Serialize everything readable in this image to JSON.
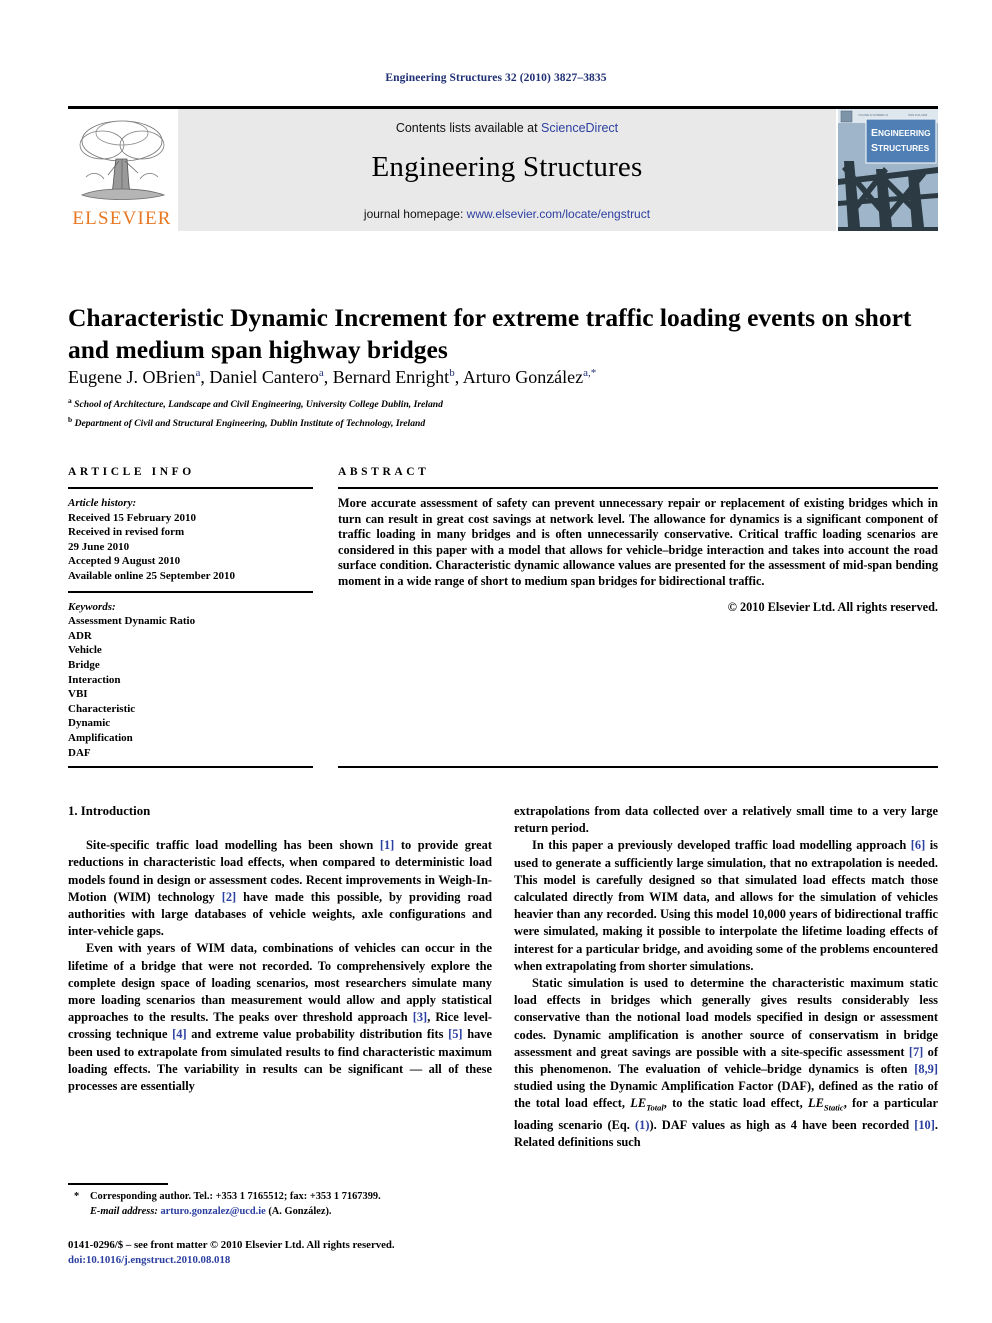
{
  "running_head": "Engineering Structures 32 (2010) 3827–3835",
  "masthead": {
    "contents_prefix": "Contents lists available at ",
    "sciencedirect": "ScienceDirect",
    "journal_title": "Engineering Structures",
    "homepage_prefix": "journal homepage: ",
    "homepage_url": "www.elsevier.com/locate/engstruct",
    "publisher_name": "ELSEVIER",
    "cover_title_line1": "ENGINEERING",
    "cover_title_line2": "STRUCTURES",
    "colors": {
      "band_bg": "#e9e9e9",
      "link": "#2b3fa0",
      "elsevier_orange": "#E87722",
      "running_head": "#1f2f74",
      "cover_blue": "#4f7fb5"
    }
  },
  "article": {
    "title": "Characteristic Dynamic Increment for extreme traffic loading events on short and medium span highway bridges",
    "authors": "Eugene J. OBrien a, Daniel Cantero a, Bernard Enright b, Arturo González a,*",
    "author_list": [
      {
        "name": "Eugene J. OBrien",
        "marks": "a"
      },
      {
        "name": "Daniel Cantero",
        "marks": "a"
      },
      {
        "name": "Bernard Enright",
        "marks": "b"
      },
      {
        "name": "Arturo González",
        "marks": "a,*"
      }
    ],
    "affiliations": [
      {
        "mark": "a",
        "text": "School of Architecture, Landscape and Civil Engineering, University College Dublin, Ireland"
      },
      {
        "mark": "b",
        "text": "Department of Civil and Structural Engineering, Dublin Institute of Technology, Ireland"
      }
    ]
  },
  "article_info": {
    "heading": "ARTICLE INFO",
    "history_label": "Article history:",
    "history": [
      "Received 15 February 2010",
      "Received in revised form",
      "29 June 2010",
      "Accepted 9 August 2010",
      "Available online 25 September 2010"
    ],
    "keywords_label": "Keywords:",
    "keywords": [
      "Assessment Dynamic Ratio",
      "ADR",
      "Vehicle",
      "Bridge",
      "Interaction",
      "VBI",
      "Characteristic",
      "Dynamic",
      "Amplification",
      "DAF"
    ]
  },
  "abstract": {
    "heading": "ABSTRACT",
    "text": "More accurate assessment of safety can prevent unnecessary repair or replacement of existing bridges which in turn can result in great cost savings at network level. The allowance for dynamics is a significant component of traffic loading in many bridges and is often unnecessarily conservative. Critical traffic loading scenarios are considered in this paper with a model that allows for vehicle–bridge interaction and takes into account the road surface condition. Characteristic dynamic allowance values are presented for the assessment of mid-span bending moment in a wide range of short to medium span bridges for bidirectional traffic.",
    "copyright": "© 2010 Elsevier Ltd. All rights reserved."
  },
  "body": {
    "section_heading": "1. Introduction",
    "left_paragraphs": [
      {
        "segments": [
          {
            "t": "Site-specific traffic load modelling has been shown "
          },
          {
            "t": "[1]",
            "k": "ref"
          },
          {
            "t": " to provide great reductions in characteristic load effects, when compared to deterministic load models found in design or assessment codes. Recent improvements in Weigh-In-Motion (WIM) technology "
          },
          {
            "t": "[2]",
            "k": "ref"
          },
          {
            "t": " have made this possible, by providing road authorities with large databases of vehicle weights, axle configurations and inter-vehicle gaps."
          }
        ]
      },
      {
        "segments": [
          {
            "t": "Even with years of WIM data, combinations of vehicles can occur in the lifetime of a bridge that were not recorded. To comprehensively explore the complete design space of loading scenarios, most researchers simulate many more loading scenarios than measurement would allow and apply statistical approaches to the results. The peaks over threshold approach "
          },
          {
            "t": "[3]",
            "k": "ref"
          },
          {
            "t": ", Rice level-crossing technique "
          },
          {
            "t": "[4]",
            "k": "ref"
          },
          {
            "t": " and extreme value probability distribution fits "
          },
          {
            "t": "[5]",
            "k": "ref"
          },
          {
            "t": " have been used to extrapolate from simulated results to find characteristic maximum loading effects. The variability in results can be significant — all of these processes are essentially"
          }
        ]
      }
    ],
    "right_paragraphs": [
      {
        "noindent": true,
        "segments": [
          {
            "t": "extrapolations from data collected over a relatively small time to a very large return period."
          }
        ]
      },
      {
        "segments": [
          {
            "t": "In this paper a previously developed traffic load modelling approach "
          },
          {
            "t": "[6]",
            "k": "ref"
          },
          {
            "t": " is used to generate a sufficiently large simulation, that no extrapolation is needed. This model is carefully designed so that simulated load effects match those calculated directly from WIM data, and allows for the simulation of vehicles heavier than any recorded. Using this model 10,000 years of bidirectional traffic were simulated, making it possible to interpolate the lifetime loading effects of interest for a particular bridge, and avoiding some of the problems encountered when extrapolating from shorter simulations."
          }
        ]
      },
      {
        "segments": [
          {
            "t": "Static simulation is used to determine the characteristic maximum static load effects in bridges which generally gives results considerably less conservative than the notional load models specified in design or assessment codes. Dynamic amplification is another source of conservatism in bridge assessment and great savings are possible with a site-specific assessment "
          },
          {
            "t": "[7]",
            "k": "ref"
          },
          {
            "t": " of this phenomenon. The evaluation of vehicle–bridge dynamics is often "
          },
          {
            "t": "[8,9]",
            "k": "ref"
          },
          {
            "t": " studied using the Dynamic Amplification Factor (DAF), defined as the ratio of the total load effect, "
          },
          {
            "t": "LE",
            "k": "ital"
          },
          {
            "t": "Total",
            "k": "sub"
          },
          {
            "t": ", to the static load effect, "
          },
          {
            "t": "LE",
            "k": "ital"
          },
          {
            "t": "Static",
            "k": "sub"
          },
          {
            "t": ", for a particular loading scenario (Eq. "
          },
          {
            "t": "(1)",
            "k": "ref"
          },
          {
            "t": "). DAF values as high as 4 have been recorded "
          },
          {
            "t": "[10]",
            "k": "ref"
          },
          {
            "t": ". Related definitions such"
          }
        ]
      }
    ]
  },
  "footnote": {
    "star": "*",
    "corresponding": "Corresponding author. Tel.: +353 1 7165512; fax: +353 1 7167399.",
    "email_label": "E-mail address:",
    "email": "arturo.gonzalez@ucd.ie",
    "email_suffix": "(A. González)."
  },
  "imprint": {
    "line1": "0141-0296/$ – see front matter © 2010 Elsevier Ltd. All rights reserved.",
    "doi": "doi:10.1016/j.engstruct.2010.08.018"
  }
}
